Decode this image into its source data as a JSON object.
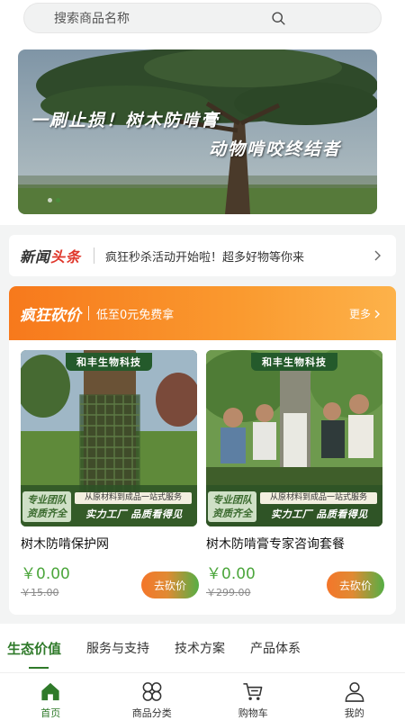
{
  "search": {
    "placeholder": "搜索商品名称"
  },
  "banner": {
    "line1": "一刷止损！树木防啃膏",
    "line2": "动物啃咬终结者",
    "slides": 2,
    "active_slide": 2
  },
  "news": {
    "label_a": "新闻",
    "label_b": "头条",
    "text": "疯狂秒杀活动开始啦！超多好物等你来"
  },
  "bargain": {
    "title": "疯狂砍价",
    "subtitle": "低至0元免费拿",
    "more": "更多",
    "products": [
      {
        "brand": "和丰生物科技",
        "tag1": "专业团队资质齐全",
        "tag2": "从原材料到成品一站式服务",
        "tag3": "实力工厂  品质看得见",
        "name": "树木防啃保护网",
        "price": "￥0.00",
        "orig": "￥15.00",
        "button": "去砍价"
      },
      {
        "brand": "和丰生物科技",
        "tag1": "专业团队资质齐全",
        "tag2": "从原材料到成品一站式服务",
        "tag3": "实力工厂  品质看得见",
        "name": "树木防啃膏专家咨询套餐",
        "price": "￥0.00",
        "orig": "￥299.00",
        "button": "去砍价"
      }
    ]
  },
  "category_tabs": [
    "生态价值",
    "服务与支持",
    "技术方案",
    "产品体系"
  ],
  "tabbar": [
    {
      "label": "首页",
      "icon": "home-icon",
      "active": true
    },
    {
      "label": "商品分类",
      "icon": "category-icon",
      "active": false
    },
    {
      "label": "购物车",
      "icon": "cart-icon",
      "active": false
    },
    {
      "label": "我的",
      "icon": "user-icon",
      "active": false
    }
  ],
  "colors": {
    "accent": "#2f7a2a",
    "orange": "#f7791c",
    "price": "#4ca63c"
  }
}
